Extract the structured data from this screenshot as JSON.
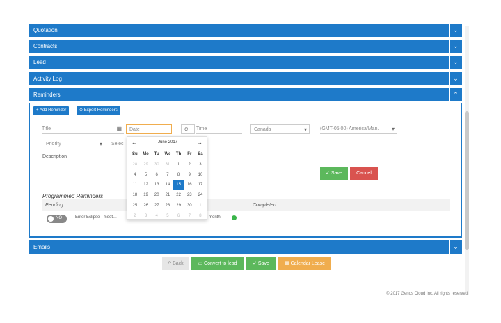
{
  "sections": [
    {
      "label": "Quotation"
    },
    {
      "label": "Contracts"
    },
    {
      "label": "Lead"
    },
    {
      "label": "Activity Log"
    },
    {
      "label": "Reminders"
    }
  ],
  "emails_label": "Emails",
  "reminders": {
    "add_button": "+ Add Reminder",
    "export_button": "⊙ Export Reminders",
    "form": {
      "title_placeholder": "Title",
      "date_placeholder": "Date",
      "time_placeholder": "Time",
      "country_value": "Canada",
      "timezone_value": "(GMT-05:00) America/Man.",
      "priority_value": "Priority",
      "select_value": "Selec",
      "description_label": "Description",
      "save_label": "✓ Save",
      "cancel_label": "Cancel"
    },
    "programmed_title": "Programmed Reminders",
    "table_headers": {
      "pending": "Pending",
      "completed": "Completed"
    },
    "row": {
      "toggle_label": "NO",
      "text": "Enter Eclipse - meet…",
      "text2": "month"
    }
  },
  "calendar": {
    "month_label": "June 2017",
    "prev": "←",
    "next": "→",
    "dow": [
      "Su",
      "Mo",
      "Tu",
      "We",
      "Th",
      "Fr",
      "Sa"
    ],
    "weeks": [
      [
        "28",
        "29",
        "30",
        "31",
        "1",
        "2",
        "3"
      ],
      [
        "4",
        "5",
        "6",
        "7",
        "8",
        "9",
        "10"
      ],
      [
        "11",
        "12",
        "13",
        "14",
        "15",
        "16",
        "17"
      ],
      [
        "18",
        "19",
        "20",
        "21",
        "22",
        "23",
        "24"
      ],
      [
        "25",
        "26",
        "27",
        "28",
        "29",
        "30",
        "1"
      ],
      [
        "2",
        "3",
        "4",
        "5",
        "6",
        "7",
        "8"
      ]
    ],
    "selected": "15"
  },
  "footer_buttons": {
    "back": "↶ Back",
    "convert": "Convert to lead",
    "save": "✓ Save",
    "calendar": "Calendar Lease"
  },
  "colors": {
    "primary": "#1e7ac9",
    "success": "#5cb85c",
    "danger": "#d9534f",
    "warning": "#f0ad4e"
  },
  "copyright": "© 2017 Genos Cloud Inc. All rights reserved"
}
